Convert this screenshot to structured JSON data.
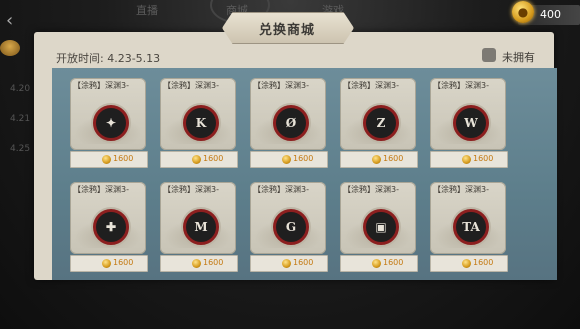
{
  "background": {
    "tabs": [
      "直播",
      "商城",
      "游戏"
    ],
    "dates": [
      "4.20",
      "4.21",
      "4.25"
    ]
  },
  "currency": {
    "icon": "gold-apple-icon",
    "value": "400"
  },
  "panel": {
    "title": "兑换商城",
    "open_time": "开放时间: 4.23-5.13",
    "own_filter_label": "未拥有"
  },
  "items": [
    {
      "name": "【涂鸦】深渊3-",
      "price": "1600",
      "glyph": "✦",
      "icon": "graffiti-emblem-icon"
    },
    {
      "name": "【涂鸦】深渊3-",
      "price": "1600",
      "glyph": "K",
      "icon": "graffiti-emblem-icon"
    },
    {
      "name": "【涂鸦】深渊3-",
      "price": "1600",
      "glyph": "Ø",
      "icon": "graffiti-emblem-icon"
    },
    {
      "name": "【涂鸦】深渊3-",
      "price": "1600",
      "glyph": "Z",
      "icon": "graffiti-emblem-icon"
    },
    {
      "name": "【涂鸦】深渊3-",
      "price": "1600",
      "glyph": "W",
      "icon": "graffiti-emblem-icon"
    },
    {
      "name": "【涂鸦】深渊3-",
      "price": "1600",
      "glyph": "✚",
      "icon": "graffiti-emblem-icon"
    },
    {
      "name": "【涂鸦】深渊3-",
      "price": "1600",
      "glyph": "M",
      "icon": "graffiti-emblem-icon"
    },
    {
      "name": "【涂鸦】深渊3-",
      "price": "1600",
      "glyph": "G",
      "icon": "graffiti-emblem-icon"
    },
    {
      "name": "【涂鸦】深渊3-",
      "price": "1600",
      "glyph": "▣",
      "icon": "graffiti-emblem-icon"
    },
    {
      "name": "【涂鸦】深渊3-",
      "price": "1600",
      "glyph": "TA",
      "icon": "graffiti-emblem-icon"
    }
  ]
}
